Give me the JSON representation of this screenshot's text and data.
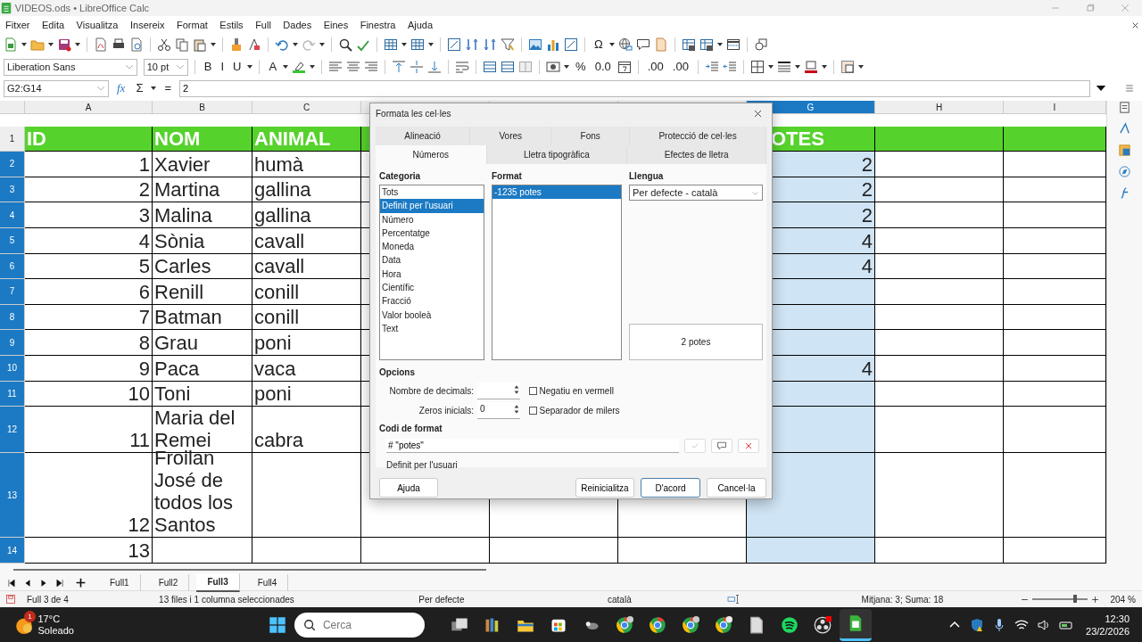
{
  "window": {
    "title": "VIDEOS.ods • LibreOffice Calc"
  },
  "menu": [
    "Fitxer",
    "Edita",
    "Visualitza",
    "Insereix",
    "Format",
    "Estils",
    "Full",
    "Dades",
    "Eines",
    "Finestra",
    "Ajuda"
  ],
  "toolbar_standard": {
    "glyphs": [
      "Ω"
    ]
  },
  "toolbar_formatting": {
    "font_name": "Liberation Sans",
    "font_size": "10 pt",
    "glyphs": [
      "B",
      "I",
      "U",
      "A",
      "%",
      "0.0",
      ".00",
      ".00"
    ]
  },
  "formula_bar": {
    "name_box": "G2:G14",
    "function_wizard": "fx",
    "sum": "Σ",
    "equals": "=",
    "input": "2"
  },
  "sheet": {
    "columns": [
      {
        "label": "A",
        "selected": false
      },
      {
        "label": "B",
        "selected": false
      },
      {
        "label": "C",
        "selected": false
      },
      {
        "selected": false
      },
      {
        "selected": false
      },
      {
        "selected": false
      },
      {
        "label": "G",
        "selected": true
      },
      {
        "label": "H",
        "selected": false
      },
      {
        "label": "I",
        "selected": false
      }
    ],
    "rows": [
      {
        "number": "1",
        "selected": false,
        "header": true,
        "A": "ID",
        "B": "NOM",
        "C": "ANIMAL",
        "G": "OTES"
      },
      {
        "number": "2",
        "selected": true,
        "A": "1",
        "B": "Xavier",
        "C": "humà",
        "G": "2"
      },
      {
        "number": "3",
        "selected": true,
        "A": "2",
        "B": "Martina",
        "C": "gallina",
        "G": "2"
      },
      {
        "number": "4",
        "selected": true,
        "A": "3",
        "B": "Malina",
        "C": "gallina",
        "G": "2"
      },
      {
        "number": "5",
        "selected": true,
        "A": "4",
        "B": "Sònia",
        "C": "cavall",
        "G": "4"
      },
      {
        "number": "6",
        "selected": true,
        "A": "5",
        "B": "Carles",
        "C": "cavall",
        "G": "4"
      },
      {
        "number": "7",
        "selected": true,
        "A": "6",
        "B": "Renill",
        "C": "conill"
      },
      {
        "number": "8",
        "selected": true,
        "A": "7",
        "B": "Batman",
        "C": "conill"
      },
      {
        "number": "9",
        "selected": true,
        "A": "8",
        "B": "Grau",
        "C": "poni"
      },
      {
        "number": "10",
        "selected": true,
        "A": "9",
        "B": "Paca",
        "C": "vaca",
        "G": "4"
      },
      {
        "number": "11",
        "selected": true,
        "A": "10",
        "B": "Toni",
        "C": "poni"
      },
      {
        "number": "12",
        "selected": true,
        "A": "11",
        "B": "Maria del Remei",
        "C": "cabra"
      },
      {
        "number": "13",
        "selected": true,
        "A": "12",
        "B": "Froilan José de todos los Santos"
      },
      {
        "number": "14",
        "selected": true,
        "A": "13"
      }
    ]
  },
  "sheet_tabs": [
    {
      "label": "Full1",
      "selected": false
    },
    {
      "label": "Full2",
      "selected": false
    },
    {
      "label": "Full3",
      "selected": true
    },
    {
      "label": "Full4",
      "selected": false
    }
  ],
  "status_bar": {
    "sheet": "Full 3 de 4",
    "selection": "13 files i 1 columna seleccionades",
    "page_style": "Per defecte",
    "language": "català",
    "summary": "Mitjana: 3; Suma: 18",
    "zoom": {
      "level": 0.77
    },
    "zoom_percent": "204 %"
  },
  "dialog": {
    "title": "Formata les cel·les",
    "tabs_row_1": [
      {
        "label": "Alineació",
        "selected": false
      },
      {
        "label": "Vores",
        "selected": false
      },
      {
        "label": "Fons",
        "selected": false
      },
      {
        "label": "Protecció de cel·les",
        "selected": false
      }
    ],
    "tabs_row_2": [
      {
        "label": "Números",
        "selected": true
      },
      {
        "label": "Lletra tipogràfica",
        "selected": false
      },
      {
        "label": "Efectes de lletra",
        "selected": false
      }
    ],
    "category_label": "Categoria",
    "categories": [
      {
        "label": "Tots",
        "selected": false
      },
      {
        "label": "Definit per l'usuari",
        "selected": true
      },
      {
        "label": "Número",
        "selected": false
      },
      {
        "label": "Percentatge",
        "selected": false
      },
      {
        "label": "Moneda",
        "selected": false
      },
      {
        "label": "Data",
        "selected": false
      },
      {
        "label": "Hora",
        "selected": false
      },
      {
        "label": "Científic",
        "selected": false
      },
      {
        "label": "Fracció",
        "selected": false
      },
      {
        "label": "Valor booleà",
        "selected": false
      },
      {
        "label": "Text",
        "selected": false
      }
    ],
    "format_label": "Format",
    "formats": [
      {
        "label": "-1235 potes",
        "selected": true
      }
    ],
    "language_label": "Llengua",
    "language": "Per defecte - català",
    "preview": "2 potes",
    "options_label": "Opcions",
    "decimals_label": "Nombre de decimals:",
    "leading_zeros_label": "Zeros inicials:",
    "leading_zeros": "0",
    "checkboxes": [
      {
        "label": "Negatiu en vermell",
        "checked": false
      },
      {
        "label": "Separador de milers",
        "checked": false
      }
    ],
    "format_code_label": "Codi de format",
    "format_code": "# \"potes\"",
    "description": "Definit per l'usuari",
    "buttons": [
      {
        "label": "Ajuda",
        "default": false
      },
      {
        "label": "Reinicialitza",
        "default": false
      },
      {
        "label": "D'acord",
        "default": true
      },
      {
        "label": "Cancel·la",
        "default": false
      }
    ]
  },
  "taskbar": {
    "weather_badge": "1",
    "temperature": "17°C",
    "weather": "Soleado",
    "search_placeholder": "Cerca",
    "time": "12:30",
    "date": "23/2/2026"
  }
}
